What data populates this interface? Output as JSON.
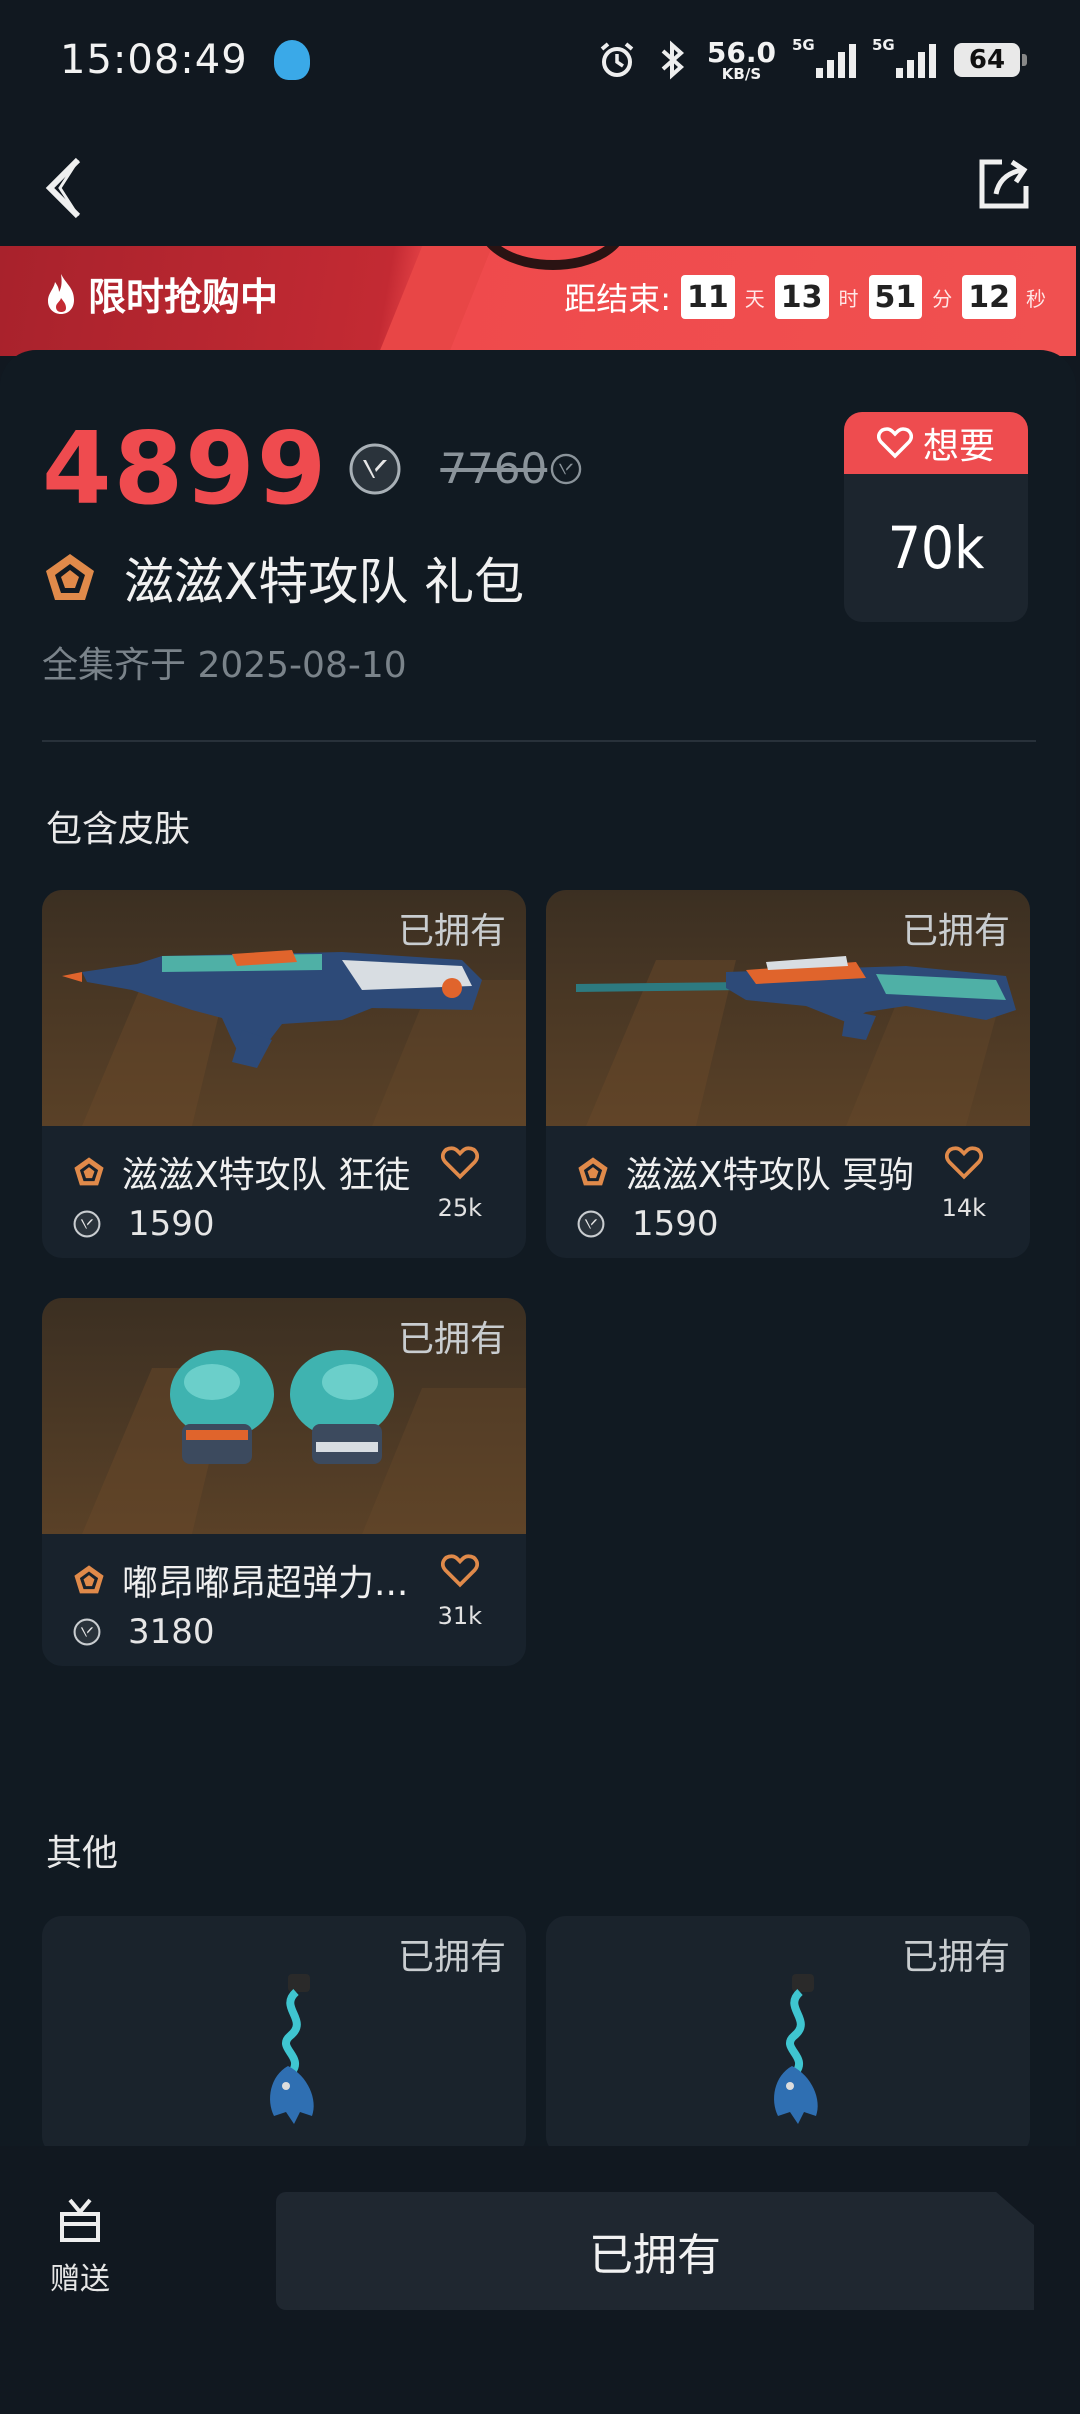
{
  "status_bar": {
    "time": "15:08:49",
    "net_speed": "56.0",
    "net_speed_unit": "KB/S",
    "signal1_label": "5G",
    "signal2_label": "5G",
    "battery": "64"
  },
  "promo": {
    "title": "限时抢购中",
    "countdown_label": "距结束:",
    "days": "11",
    "days_unit": "天",
    "hours": "13",
    "hours_unit": "时",
    "minutes": "51",
    "minutes_unit": "分",
    "seconds": "12",
    "seconds_unit": "秒"
  },
  "bundle": {
    "price": "4899",
    "original_price": "7760",
    "title": "滋滋X特攻队 礼包",
    "complete_date": "全集齐于 2025-08-10",
    "want_label": "想要",
    "want_count": "70k"
  },
  "sections": {
    "skins_title": "包含皮肤",
    "others_title": "其他"
  },
  "skins": [
    {
      "name": "滋滋X特攻队 狂徒",
      "price": "1590",
      "likes": "25k",
      "owned": "已拥有"
    },
    {
      "name": "滋滋X特攻队 冥驹",
      "price": "1590",
      "likes": "14k",
      "owned": "已拥有"
    },
    {
      "name": "嘟昂嘟昂超弹力...",
      "price": "3180",
      "likes": "31k",
      "owned": "已拥有"
    }
  ],
  "others": [
    {
      "owned": "已拥有"
    },
    {
      "owned": "已拥有"
    }
  ],
  "bottom": {
    "gift_label": "赠送",
    "action_label": "已拥有"
  },
  "colors": {
    "accent_red": "#ef4b4f",
    "tier_orange": "#e08a4a",
    "background": "#111820"
  }
}
